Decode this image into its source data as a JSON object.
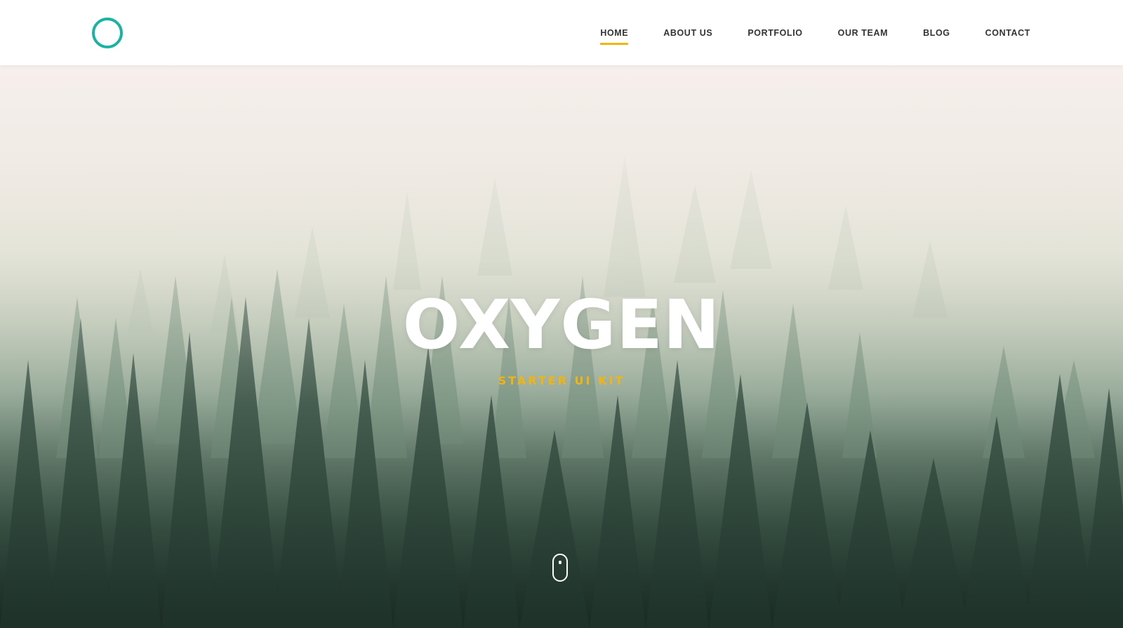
{
  "header": {
    "logo_icon": "ring-logo",
    "nav": [
      {
        "label": "HOME",
        "active": true
      },
      {
        "label": "ABOUT US",
        "active": false
      },
      {
        "label": "PORTFOLIO",
        "active": false
      },
      {
        "label": "OUR TEAM",
        "active": false
      },
      {
        "label": "BLOG",
        "active": false
      },
      {
        "label": "CONTACT",
        "active": false
      }
    ]
  },
  "hero": {
    "title": "OXYGEN",
    "subtitle": "STARTER UI KIT",
    "background": "misty-pine-forest",
    "scroll_icon": "mouse-scroll-icon"
  },
  "colors": {
    "accent_teal": "#17b3a3",
    "accent_yellow": "#f2b50f",
    "nav_text": "#333333",
    "header_bg": "#ffffff"
  }
}
